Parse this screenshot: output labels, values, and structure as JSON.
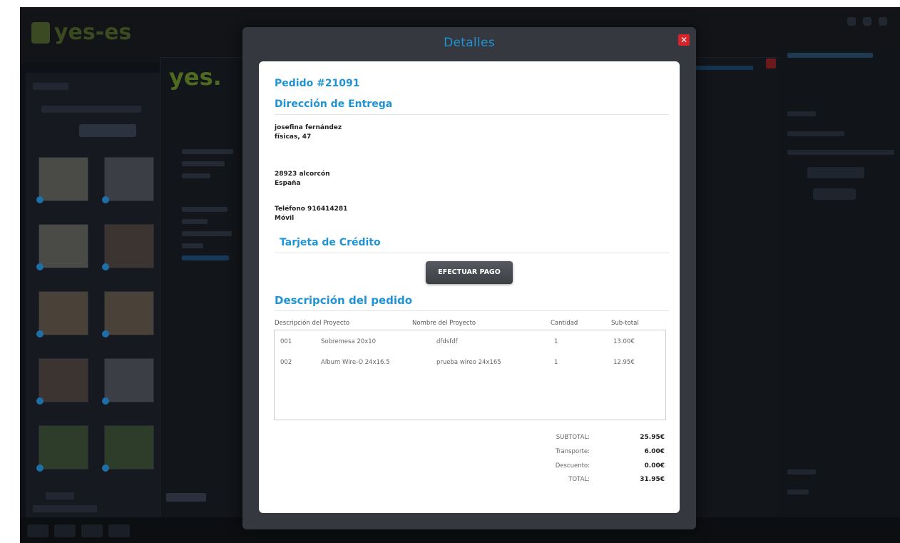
{
  "background": {
    "logo_text": "yes-es",
    "mid_logo_text": "yes."
  },
  "modal": {
    "title": "Detalles",
    "close_label": "✕"
  },
  "order": {
    "number": "Pedido #21091"
  },
  "delivery": {
    "heading": "Dirección de Entrega",
    "name": "josefina fernández",
    "street": "físicas, 47",
    "city": "28923 alcorcón",
    "country": "España",
    "phone": "Teléfono 916414281",
    "mobile": "Móvil"
  },
  "payment": {
    "heading": "Tarjeta de Crédito",
    "button": "EFECTUAR PAGO"
  },
  "items": {
    "heading": "Descripción del pedido",
    "columns": [
      "Descripción del Proyecto",
      "Nombre del Proyecto",
      "Cantidad",
      "Sub-total"
    ],
    "rows": [
      {
        "code": "001",
        "description": "Sobremesa 20x10",
        "name": "dfdsfdf",
        "qty": "1",
        "subtotal": "13.00€"
      },
      {
        "code": "002",
        "description": "Album Wire-O 24x16.5",
        "name": "prueba wireo 24x165",
        "qty": "1",
        "subtotal": "12.95€"
      }
    ]
  },
  "totals": {
    "subtotal_label": "SUBTOTAL:",
    "subtotal_value": "25.95€",
    "shipping_label": "Transporte:",
    "shipping_value": "6.00€",
    "discount_label": "Descuento:",
    "discount_value": "0.00€",
    "total_label": "TOTAL:",
    "total_value": "31.95€"
  },
  "colors": {
    "accent": "#1f93d4",
    "close": "#d8232a",
    "modal_frame": "#35383e"
  }
}
